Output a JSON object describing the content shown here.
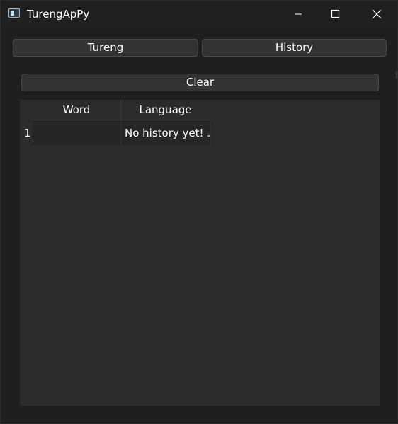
{
  "window": {
    "title": "TurengApPy"
  },
  "tabs": {
    "tureng_label": "Tureng",
    "history_label": "History"
  },
  "actions": {
    "clear_label": "Clear"
  },
  "history_table": {
    "columns": [
      "Word",
      "Language"
    ],
    "rows": [
      {
        "row_number": "1",
        "word": "",
        "language": "No history yet! ..."
      }
    ]
  },
  "colors": {
    "background": "#1f1f1f",
    "button": "#333333",
    "table": "#2c2c2c",
    "text": "#ffffff"
  },
  "icons": {
    "app": "app-window-icon",
    "minimize": "minimize-icon",
    "maximize": "maximize-icon",
    "close": "close-icon"
  }
}
